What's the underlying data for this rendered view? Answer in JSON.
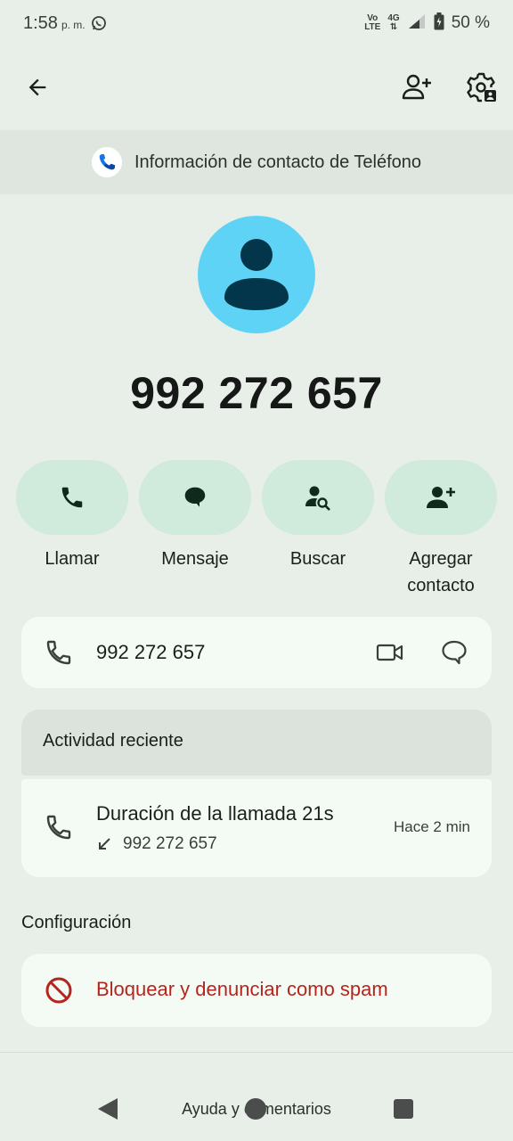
{
  "status_bar": {
    "time": "1:58",
    "ampm": "p. m.",
    "network_top": "Vo",
    "network_bottom": "LTE",
    "network_type": "4G",
    "battery": "50 %"
  },
  "app_bar": {
    "back_icon": "arrow-left-icon",
    "add_contact_icon": "person-add-icon",
    "settings_icon": "settings-account-icon"
  },
  "banner": {
    "text": "Información de contacto de Teléfono",
    "icon": "phone-app-logo-icon"
  },
  "contact": {
    "number": "992 272 657"
  },
  "actions": [
    {
      "label": "Llamar",
      "icon": "phone-icon"
    },
    {
      "label": "Mensaje",
      "icon": "message-icon"
    },
    {
      "label": "Buscar",
      "icon": "person-search-icon"
    },
    {
      "label": "Agregar contacto",
      "icon": "person-add-icon"
    }
  ],
  "number_card": {
    "number": "992 272 657",
    "video_icon": "videocam-icon",
    "message_icon": "chat-bubble-icon"
  },
  "recent_activity": {
    "heading": "Actividad reciente",
    "item": {
      "title": "Duración de la llamada 21s",
      "number": "992 272 657",
      "time": "Hace 2 min",
      "direction_icon": "incoming-call-arrow-icon"
    }
  },
  "settings": {
    "heading": "Configuración",
    "block_label": "Bloquear y denunciar como spam"
  },
  "footer": {
    "help": "Ayuda y comentarios"
  },
  "colors": {
    "background": "#e8eee8",
    "action_pill": "#d0eadb",
    "avatar": "#5fd3f5",
    "danger": "#b3261e"
  }
}
